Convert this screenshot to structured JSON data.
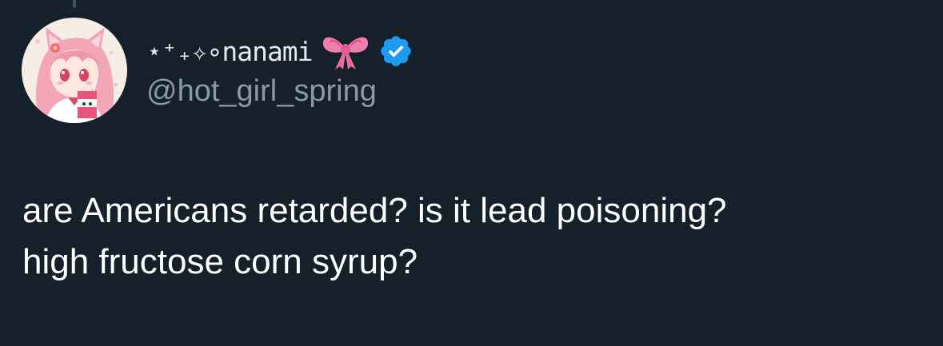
{
  "colors": {
    "background": "#15202b",
    "text_primary": "#ffffff",
    "text_secondary": "#8b98a5",
    "verified_blue": "#1d9bf0",
    "bow_pink": "#f27eab"
  },
  "author": {
    "display_name": "⋆⁺₊✧∘nanami",
    "name_emoji": "ribbon-bow-icon",
    "verified": "verified-badge-icon",
    "handle": "@hot_girl_spring",
    "avatar": "anime-girl-avatar"
  },
  "tweet": {
    "lines": [
      "are Americans retarded? is it lead poisoning?",
      "high fructose corn syrup?"
    ]
  }
}
